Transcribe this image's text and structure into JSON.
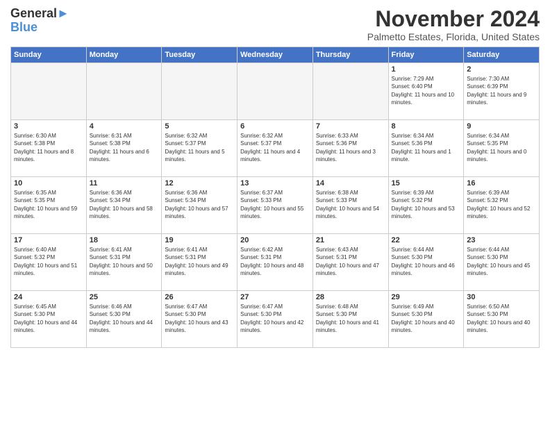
{
  "header": {
    "logo_line1": "General",
    "logo_line2": "Blue",
    "month_title": "November 2024",
    "subtitle": "Palmetto Estates, Florida, United States"
  },
  "weekdays": [
    "Sunday",
    "Monday",
    "Tuesday",
    "Wednesday",
    "Thursday",
    "Friday",
    "Saturday"
  ],
  "weeks": [
    [
      {
        "day": "",
        "empty": true
      },
      {
        "day": "",
        "empty": true
      },
      {
        "day": "",
        "empty": true
      },
      {
        "day": "",
        "empty": true
      },
      {
        "day": "",
        "empty": true
      },
      {
        "day": "1",
        "sunrise": "Sunrise: 7:29 AM",
        "sunset": "Sunset: 6:40 PM",
        "daylight": "Daylight: 11 hours and 10 minutes."
      },
      {
        "day": "2",
        "sunrise": "Sunrise: 7:30 AM",
        "sunset": "Sunset: 6:39 PM",
        "daylight": "Daylight: 11 hours and 9 minutes."
      }
    ],
    [
      {
        "day": "3",
        "sunrise": "Sunrise: 6:30 AM",
        "sunset": "Sunset: 5:38 PM",
        "daylight": "Daylight: 11 hours and 8 minutes."
      },
      {
        "day": "4",
        "sunrise": "Sunrise: 6:31 AM",
        "sunset": "Sunset: 5:38 PM",
        "daylight": "Daylight: 11 hours and 6 minutes."
      },
      {
        "day": "5",
        "sunrise": "Sunrise: 6:32 AM",
        "sunset": "Sunset: 5:37 PM",
        "daylight": "Daylight: 11 hours and 5 minutes."
      },
      {
        "day": "6",
        "sunrise": "Sunrise: 6:32 AM",
        "sunset": "Sunset: 5:37 PM",
        "daylight": "Daylight: 11 hours and 4 minutes."
      },
      {
        "day": "7",
        "sunrise": "Sunrise: 6:33 AM",
        "sunset": "Sunset: 5:36 PM",
        "daylight": "Daylight: 11 hours and 3 minutes."
      },
      {
        "day": "8",
        "sunrise": "Sunrise: 6:34 AM",
        "sunset": "Sunset: 5:36 PM",
        "daylight": "Daylight: 11 hours and 1 minute."
      },
      {
        "day": "9",
        "sunrise": "Sunrise: 6:34 AM",
        "sunset": "Sunset: 5:35 PM",
        "daylight": "Daylight: 11 hours and 0 minutes."
      }
    ],
    [
      {
        "day": "10",
        "sunrise": "Sunrise: 6:35 AM",
        "sunset": "Sunset: 5:35 PM",
        "daylight": "Daylight: 10 hours and 59 minutes."
      },
      {
        "day": "11",
        "sunrise": "Sunrise: 6:36 AM",
        "sunset": "Sunset: 5:34 PM",
        "daylight": "Daylight: 10 hours and 58 minutes."
      },
      {
        "day": "12",
        "sunrise": "Sunrise: 6:36 AM",
        "sunset": "Sunset: 5:34 PM",
        "daylight": "Daylight: 10 hours and 57 minutes."
      },
      {
        "day": "13",
        "sunrise": "Sunrise: 6:37 AM",
        "sunset": "Sunset: 5:33 PM",
        "daylight": "Daylight: 10 hours and 55 minutes."
      },
      {
        "day": "14",
        "sunrise": "Sunrise: 6:38 AM",
        "sunset": "Sunset: 5:33 PM",
        "daylight": "Daylight: 10 hours and 54 minutes."
      },
      {
        "day": "15",
        "sunrise": "Sunrise: 6:39 AM",
        "sunset": "Sunset: 5:32 PM",
        "daylight": "Daylight: 10 hours and 53 minutes."
      },
      {
        "day": "16",
        "sunrise": "Sunrise: 6:39 AM",
        "sunset": "Sunset: 5:32 PM",
        "daylight": "Daylight: 10 hours and 52 minutes."
      }
    ],
    [
      {
        "day": "17",
        "sunrise": "Sunrise: 6:40 AM",
        "sunset": "Sunset: 5:32 PM",
        "daylight": "Daylight: 10 hours and 51 minutes."
      },
      {
        "day": "18",
        "sunrise": "Sunrise: 6:41 AM",
        "sunset": "Sunset: 5:31 PM",
        "daylight": "Daylight: 10 hours and 50 minutes."
      },
      {
        "day": "19",
        "sunrise": "Sunrise: 6:41 AM",
        "sunset": "Sunset: 5:31 PM",
        "daylight": "Daylight: 10 hours and 49 minutes."
      },
      {
        "day": "20",
        "sunrise": "Sunrise: 6:42 AM",
        "sunset": "Sunset: 5:31 PM",
        "daylight": "Daylight: 10 hours and 48 minutes."
      },
      {
        "day": "21",
        "sunrise": "Sunrise: 6:43 AM",
        "sunset": "Sunset: 5:31 PM",
        "daylight": "Daylight: 10 hours and 47 minutes."
      },
      {
        "day": "22",
        "sunrise": "Sunrise: 6:44 AM",
        "sunset": "Sunset: 5:30 PM",
        "daylight": "Daylight: 10 hours and 46 minutes."
      },
      {
        "day": "23",
        "sunrise": "Sunrise: 6:44 AM",
        "sunset": "Sunset: 5:30 PM",
        "daylight": "Daylight: 10 hours and 45 minutes."
      }
    ],
    [
      {
        "day": "24",
        "sunrise": "Sunrise: 6:45 AM",
        "sunset": "Sunset: 5:30 PM",
        "daylight": "Daylight: 10 hours and 44 minutes."
      },
      {
        "day": "25",
        "sunrise": "Sunrise: 6:46 AM",
        "sunset": "Sunset: 5:30 PM",
        "daylight": "Daylight: 10 hours and 44 minutes."
      },
      {
        "day": "26",
        "sunrise": "Sunrise: 6:47 AM",
        "sunset": "Sunset: 5:30 PM",
        "daylight": "Daylight: 10 hours and 43 minutes."
      },
      {
        "day": "27",
        "sunrise": "Sunrise: 6:47 AM",
        "sunset": "Sunset: 5:30 PM",
        "daylight": "Daylight: 10 hours and 42 minutes."
      },
      {
        "day": "28",
        "sunrise": "Sunrise: 6:48 AM",
        "sunset": "Sunset: 5:30 PM",
        "daylight": "Daylight: 10 hours and 41 minutes."
      },
      {
        "day": "29",
        "sunrise": "Sunrise: 6:49 AM",
        "sunset": "Sunset: 5:30 PM",
        "daylight": "Daylight: 10 hours and 40 minutes."
      },
      {
        "day": "30",
        "sunrise": "Sunrise: 6:50 AM",
        "sunset": "Sunset: 5:30 PM",
        "daylight": "Daylight: 10 hours and 40 minutes."
      }
    ]
  ]
}
